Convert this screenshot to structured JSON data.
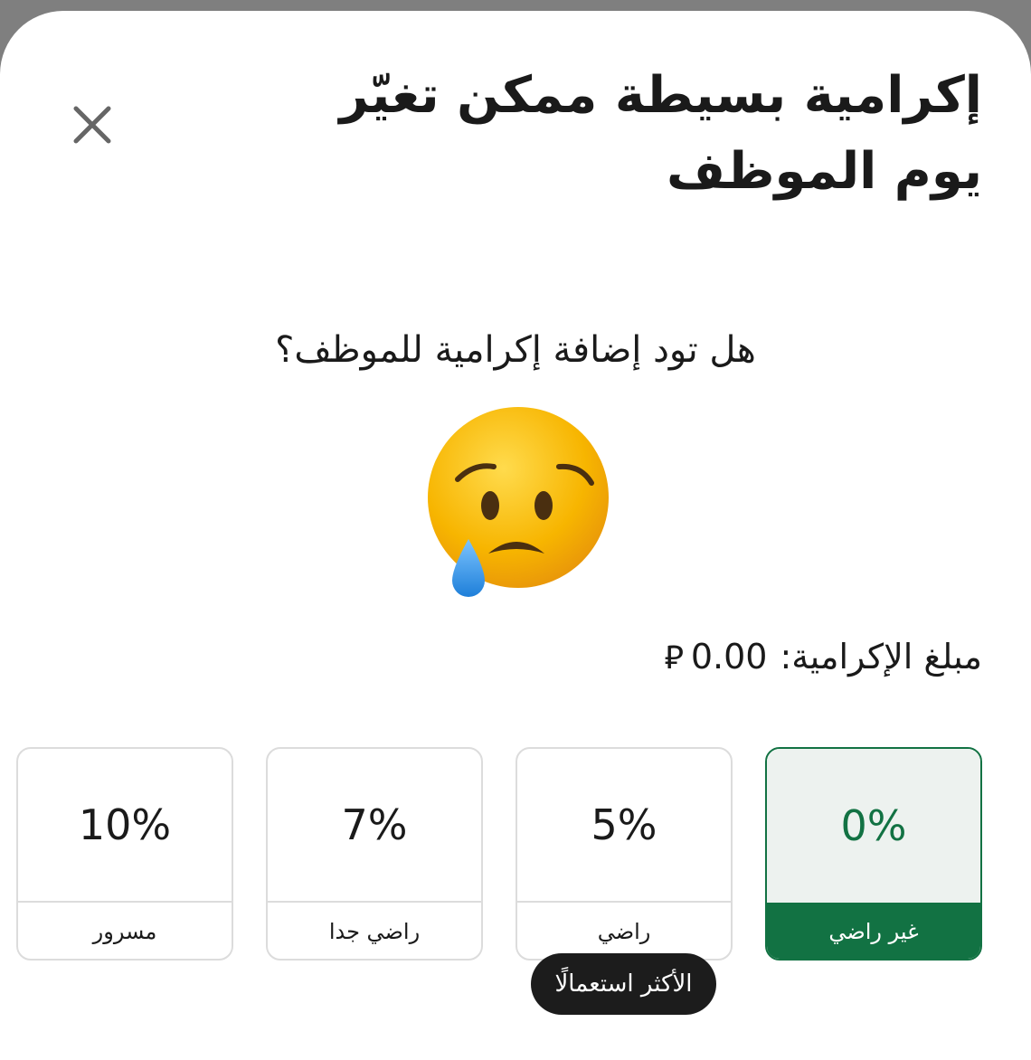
{
  "sheet": {
    "title": "إكرامية بسيطة ممكن تغيّر يوم الموظف",
    "close_icon": "close-icon"
  },
  "prompt": {
    "question": "هل تود إضافة إكرامية للموظف؟",
    "emoji_icon": "sad-tear-emoji-icon"
  },
  "amount": {
    "label": "مبلغ الإكرامية:",
    "currency_icon": "saudi-riyal-icon",
    "currency_symbol": "⃁",
    "value": "0.00"
  },
  "options": [
    {
      "percent": "0%",
      "label": "غير راضي",
      "selected": true
    },
    {
      "percent": "5%",
      "label": "راضي",
      "selected": false
    },
    {
      "percent": "7%",
      "label": "راضي جدا",
      "selected": false
    },
    {
      "percent": "10%",
      "label": "مسرور",
      "selected": false
    }
  ],
  "badge": {
    "text": "الأكثر استعمالًا"
  },
  "colors": {
    "accent": "#127243",
    "selected_bg": "#edf2ef",
    "badge_bg": "#1c1c1c",
    "border": "#dcdcdc"
  }
}
